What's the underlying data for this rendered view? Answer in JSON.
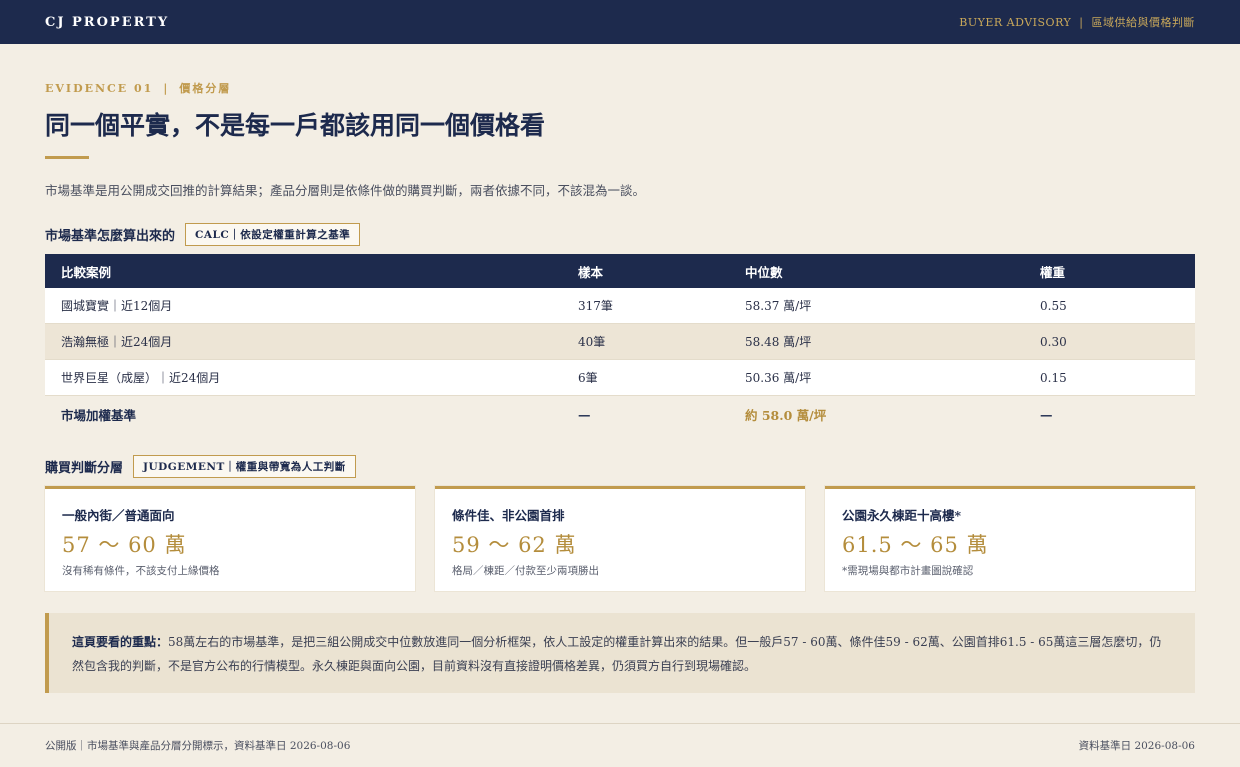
{
  "header": {
    "brand": "CJ PROPERTY",
    "nav_left": "BUYER ADVISORY",
    "nav_sep": "|",
    "nav_right": "區域供給與價格判斷"
  },
  "eyebrow": {
    "index": "EVIDENCE 01",
    "sep": "|",
    "label": "價格分層"
  },
  "title": "同一個平實，不是每一戶都該用同一個價格看",
  "intro": "市場基準是用公開成交回推的計算結果；產品分層則是依條件做的購買判斷，兩者依據不同，不該混為一談。",
  "calc_section": {
    "label": "市場基準怎麼算出來的",
    "tag": "CALC｜依設定權重計算之基準"
  },
  "table": {
    "headers": [
      "比較案例",
      "樣本",
      "中位數",
      "權重"
    ],
    "rows": [
      [
        "國城寶實｜近12個月",
        "317筆",
        "58.37 萬/坪",
        "0.55"
      ],
      [
        "浩瀚無極｜近24個月",
        "40筆",
        "58.48 萬/坪",
        "0.30"
      ],
      [
        "世界巨星（成屋）｜近24個月",
        "6筆",
        "50.36 萬/坪",
        "0.15"
      ]
    ],
    "total": [
      "市場加權基準",
      "—",
      "約 58.0 萬/坪",
      "—"
    ]
  },
  "judgement_section": {
    "label": "購買判斷分層",
    "tag": "JUDGEMENT｜權重與帶寬為人工判斷"
  },
  "cards": [
    {
      "title": "一般內街／普通面向",
      "value": "57 ～ 60 萬",
      "note": "沒有稀有條件，不該支付上緣價格"
    },
    {
      "title": "條件佳、非公園首排",
      "value": "59 ～ 62 萬",
      "note": "格局／棟距／付款至少兩項勝出"
    },
    {
      "title": "公園永久棟距十高樓*",
      "value": "61.5 ～ 65 萬",
      "note": "*需現場與都市計畫圖說確認"
    }
  ],
  "callout": {
    "lead": "這頁要看的重點：",
    "body": "58萬左右的市場基準，是把三組公開成交中位數放進同一個分析框架，依人工設定的權重計算出來的結果。但一般戶57 - 60萬、條件佳59 - 62萬、公園首排61.5 - 65萬這三層怎麼切，仍然包含我的判斷，不是官方公布的行情模型。永久棟距與面向公園，目前資料沒有直接證明價格差異，仍須買方自行到現場確認。"
  },
  "footer": {
    "left": "公開版｜市場基準與產品分層分開標示，資料基準日 2026-08-06",
    "right": "資料基準日 2026-08-06"
  }
}
